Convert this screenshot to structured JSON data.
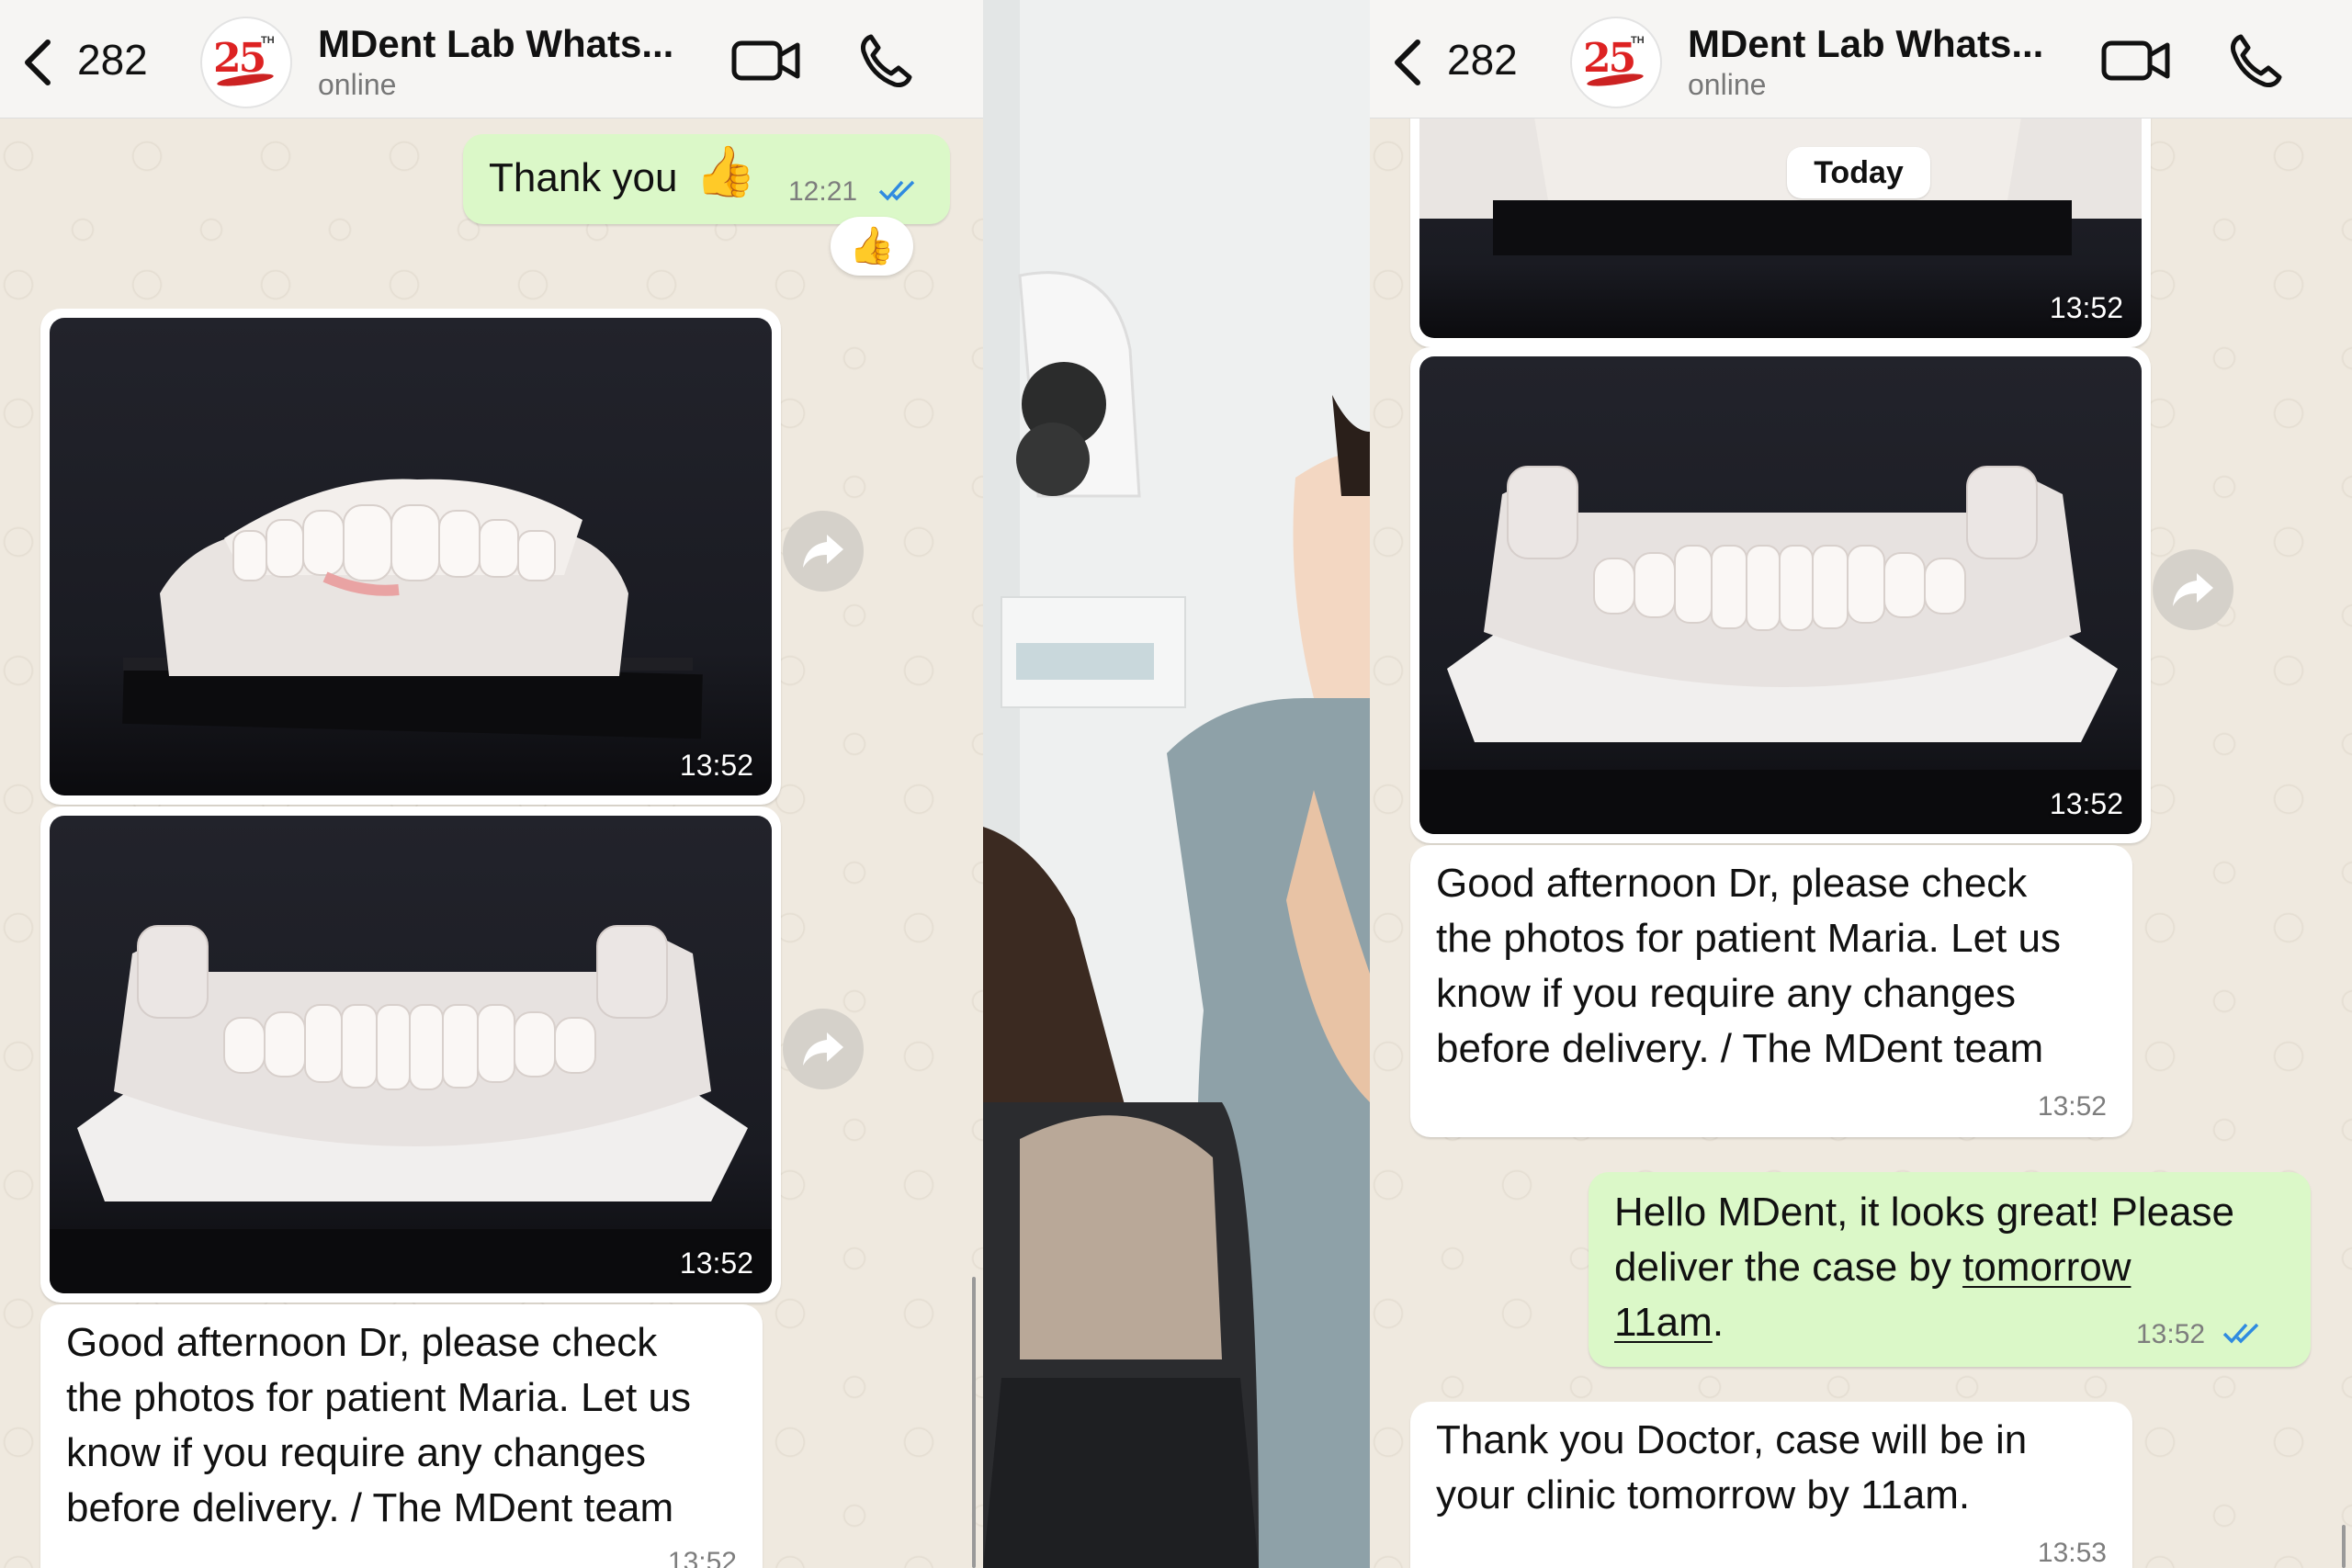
{
  "header": {
    "back_count": "282",
    "title": "MDent Lab Whats...",
    "status": "online",
    "avatar_text": "25",
    "avatar_sup": "TH"
  },
  "left": {
    "sent_thanks": {
      "text": "Thank you",
      "emoji": "👍",
      "time": "12:21"
    },
    "reaction": "👍",
    "photo1_time": "13:52",
    "photo2_time": "13:52",
    "incoming": {
      "lines": [
        "Good afternoon Dr, please check",
        "the photos for patient Maria. Let us",
        "know if you require any changes",
        "before delivery. / The MDent team"
      ],
      "time": "13:52"
    }
  },
  "right": {
    "photo_top_time": "13:52",
    "date_chip": "Today",
    "photo2_time": "13:52",
    "incoming": {
      "lines": [
        "Good afternoon Dr, please check",
        "the photos for patient Maria. Let us",
        "know if you require any changes",
        "before delivery. / The MDent team"
      ],
      "time": "13:52"
    },
    "outgoing": {
      "line1": "Hello MDent, it looks great! Please",
      "line2_prefix": "deliver the case by ",
      "line2_link": "tomorrow",
      "line3_link": "11am",
      "line3_suffix": ".",
      "time": "13:52"
    },
    "reply": {
      "lines": [
        "Thank you Doctor, case will be in",
        "your clinic tomorrow by 11am."
      ],
      "time": "13:53"
    }
  },
  "colors": {
    "outgoing_bubble": "#dbf8c8",
    "incoming_bubble": "#ffffff",
    "read_ticks": "#2f8be0",
    "header_bg": "#f6f5f3"
  },
  "icons": [
    "chevron-left-icon",
    "video-call-icon",
    "phone-icon",
    "double-check-icon",
    "forward-icon"
  ]
}
